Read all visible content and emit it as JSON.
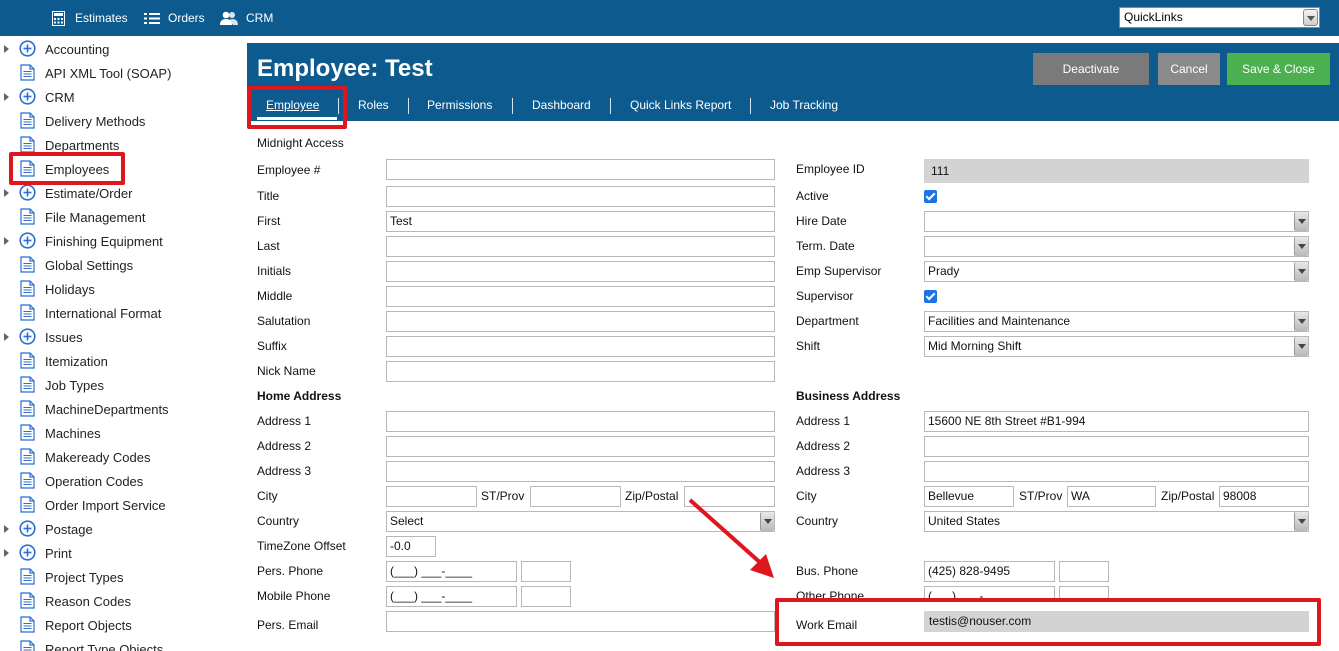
{
  "topnav": {
    "estimates": "Estimates",
    "orders": "Orders",
    "crm": "CRM",
    "quicklinks": "QuickLinks"
  },
  "sidebar": {
    "items": [
      {
        "label": "Accounting",
        "type": "plus"
      },
      {
        "label": "API XML Tool (SOAP)",
        "type": "doc"
      },
      {
        "label": "CRM",
        "type": "plus"
      },
      {
        "label": "Delivery Methods",
        "type": "doc"
      },
      {
        "label": "Departments",
        "type": "doc"
      },
      {
        "label": "Employees",
        "type": "doc"
      },
      {
        "label": "Estimate/Order",
        "type": "plus"
      },
      {
        "label": "File Management",
        "type": "doc"
      },
      {
        "label": "Finishing Equipment",
        "type": "plus"
      },
      {
        "label": "Global Settings",
        "type": "doc"
      },
      {
        "label": "Holidays",
        "type": "doc"
      },
      {
        "label": "International Format",
        "type": "doc"
      },
      {
        "label": "Issues",
        "type": "plus"
      },
      {
        "label": "Itemization",
        "type": "doc"
      },
      {
        "label": "Job Types",
        "type": "doc"
      },
      {
        "label": "MachineDepartments",
        "type": "doc"
      },
      {
        "label": "Machines",
        "type": "doc"
      },
      {
        "label": "Makeready Codes",
        "type": "doc"
      },
      {
        "label": "Operation Codes",
        "type": "doc"
      },
      {
        "label": "Order Import Service",
        "type": "doc"
      },
      {
        "label": "Postage",
        "type": "plus"
      },
      {
        "label": "Print",
        "type": "plus"
      },
      {
        "label": "Project Types",
        "type": "doc"
      },
      {
        "label": "Reason Codes",
        "type": "doc"
      },
      {
        "label": "Report Objects",
        "type": "doc"
      },
      {
        "label": "Report Type Objects",
        "type": "doc"
      }
    ]
  },
  "header": {
    "title": "Employee: Test",
    "deactivate": "Deactivate",
    "cancel": "Cancel",
    "save_close": "Save & Close",
    "tabs": [
      "Employee",
      "Roles",
      "Permissions",
      "Dashboard",
      "Quick Links Report",
      "Job Tracking"
    ]
  },
  "form": {
    "midnight_access": "Midnight Access",
    "left": {
      "employee_no": {
        "label": "Employee #",
        "value": ""
      },
      "title": {
        "label": "Title",
        "value": ""
      },
      "first": {
        "label": "First",
        "value": "Test"
      },
      "last": {
        "label": "Last",
        "value": ""
      },
      "initials": {
        "label": "Initials",
        "value": ""
      },
      "middle": {
        "label": "Middle",
        "value": ""
      },
      "salutation": {
        "label": "Salutation",
        "value": ""
      },
      "suffix": {
        "label": "Suffix",
        "value": ""
      },
      "nick_name": {
        "label": "Nick Name",
        "value": ""
      },
      "home_address": "Home Address",
      "address1": {
        "label": "Address 1",
        "value": ""
      },
      "address2": {
        "label": "Address 2",
        "value": ""
      },
      "address3": {
        "label": "Address 3",
        "value": ""
      },
      "city": {
        "label": "City",
        "value": ""
      },
      "st_prov": {
        "label": "ST/Prov",
        "value": ""
      },
      "zip": {
        "label": "Zip/Postal",
        "value": ""
      },
      "country": {
        "label": "Country",
        "value": "Select"
      },
      "timezone": {
        "label": "TimeZone Offset",
        "value": "-0.0"
      },
      "pers_phone": {
        "label": "Pers. Phone",
        "value": "(___) ___-____"
      },
      "mobile_phone": {
        "label": "Mobile Phone",
        "value": "(___) ___-____"
      },
      "pers_email": {
        "label": "Pers. Email",
        "value": ""
      }
    },
    "right": {
      "employee_id": {
        "label": "Employee ID",
        "value": "111"
      },
      "active": {
        "label": "Active",
        "checked": true
      },
      "hire_date": {
        "label": "Hire Date",
        "value": ""
      },
      "term_date": {
        "label": "Term. Date",
        "value": ""
      },
      "emp_supervisor": {
        "label": "Emp Supervisor",
        "value": "Prady"
      },
      "supervisor": {
        "label": "Supervisor",
        "checked": true
      },
      "department": {
        "label": "Department",
        "value": "Facilities and Maintenance"
      },
      "shift": {
        "label": "Shift",
        "value": "Mid Morning Shift"
      },
      "business_address": "Business Address",
      "address1": {
        "label": "Address 1",
        "value": "15600 NE 8th Street #B1-994"
      },
      "address2": {
        "label": "Address 2",
        "value": ""
      },
      "address3": {
        "label": "Address 3",
        "value": ""
      },
      "city": {
        "label": "City",
        "value": "Bellevue"
      },
      "st_prov": {
        "label": "ST/Prov",
        "value": "WA"
      },
      "zip": {
        "label": "Zip/Postal",
        "value": "98008"
      },
      "country": {
        "label": "Country",
        "value": "United States"
      },
      "bus_phone": {
        "label": "Bus. Phone",
        "value": "(425) 828-9495"
      },
      "other_phone": {
        "label": "Other Phone",
        "value": "(___) ___-____"
      },
      "work_email": {
        "label": "Work Email",
        "value": "testis@nouser.com"
      }
    }
  },
  "colors": {
    "header_blue": "#0d5b8e",
    "deactivate_gray": "#7a7a7a",
    "cancel_gray": "#8a8a8a",
    "save_green": "#4caf50",
    "annotation_red": "#e0161f"
  }
}
